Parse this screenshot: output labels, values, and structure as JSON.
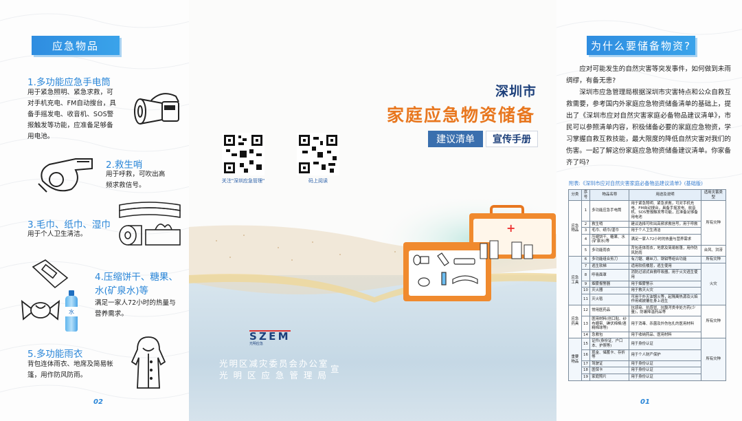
{
  "left": {
    "title": "应急物品",
    "page_number": "02",
    "items": [
      {
        "heading": "1.多功能应急手电筒",
        "desc": "用于紧急照明、紧急求救，可对手机充电、FM自动搜台，具备手摇发电、收音机、SOS警报触发等功能，应准备足够备用电池。"
      },
      {
        "heading": "2.救生哨",
        "desc": "用于呼救，可吹出高频求救信号。"
      },
      {
        "heading": "3.毛巾、纸巾、湿巾",
        "desc": "用于个人卫生清洁。"
      },
      {
        "heading": "4.压缩饼干、糖果、水(矿泉水)等",
        "desc": "满足一家人72小时的热量与营养需求。"
      },
      {
        "heading": "5.多功能雨衣",
        "desc": "背包连体雨衣、地席及简易帐篷，用作防风防雨。"
      }
    ],
    "water_label": "水"
  },
  "middle": {
    "title_line1": "深圳市",
    "title_line2": "家庭应急物资储备",
    "tag1": "建议清单",
    "tag2": "宣传手册",
    "qr1_caption": "关注\"深圳应急管理\"",
    "qr2_caption": "码上阅读",
    "logo_text": "光明应急",
    "org_line1": "光明区减灾委员会办公室",
    "org_line2": "光 明 区 应 急 管 理 局",
    "org_suffix": "宣",
    "kit_cross_label": "+"
  },
  "right": {
    "title": "为什么要储备物资?",
    "paragraphs": [
      "应对可能发生的自然灾害等突发事件，如何做到未雨绸缪，有备无患?",
      "深圳市应急管理局根据深圳市灾害特点和公众自救互救需要，参考国内外家庭应急物资储备清单的基础上，提出了《深圳市应对自然灾害家庭必备物品建议清单》，市民可以参照清单内容，积极储备必要的家庭应急物资，学习掌握自救互救技能，最大限度的降低自然灾害对我们的伤害。一起了解这份家庭应急物资储备建议清单。你家备齐了吗?"
    ],
    "annex_title": "附表:《深圳市应对自然灾害家庭必备物品建议清单》(基础版)",
    "page_number": "01",
    "table": {
      "headers": [
        "分类",
        "序号",
        "物品名称",
        "用途及说明",
        "适用灾害类型"
      ],
      "groups": [
        {
          "category": "应急物品",
          "rows": [
            {
              "no": "1",
              "name": "多功能应急手电筒",
              "use": "用于紧急照明、紧急求救，可对手机充电、FM自动搜台，具备手摇发电、收音机、SOS警报触发等功能，应准备足够备用电池"
            },
            {
              "no": "2",
              "name": "救生哨",
              "use": "建议选择可吹出高频求救信号，用于呼救"
            },
            {
              "no": "3",
              "name": "毛巾、纸巾/湿巾",
              "use": "用于个人卫生清洁"
            },
            {
              "no": "4",
              "name": "压缩饼干、糖果、水(矿泉水)等",
              "use": "满足一家人72小时的热量与营养需求"
            },
            {
              "no": "5",
              "name": "多功能雨衣",
              "use": "背包连体雨衣，地席及简易帐篷，用作防风防雨"
            }
          ]
        },
        {
          "category": "应急工具",
          "rows": [
            {
              "no": "6",
              "name": "多功能组合剪刀",
              "use": "有刀锯、螺丝刀、钢钳等组合功能"
            },
            {
              "no": "7",
              "name": "逃生软梯",
              "use": "适用较低楼层，逃生使用"
            },
            {
              "no": "8",
              "name": "呼吸面罩",
              "use": "消防过滤式自救呼吸器，用于火灾逃生使用"
            },
            {
              "no": "9",
              "name": "烟雾报警器",
              "use": "用于烟雾警示"
            },
            {
              "no": "10",
              "name": "灭火器",
              "use": "用于救灭火灾"
            },
            {
              "no": "11",
              "name": "灭火毯",
              "use": "可用于扑灭油锅火等，起隔离热源及火焰作用或披覆在身上逃生"
            }
          ]
        },
        {
          "category": "应急药具",
          "rows": [
            {
              "no": "12",
              "name": "常用医药品",
              "use": "抗感染、抗感冒、抗腹泻类非处方药(少量)，防暑降温药品等"
            },
            {
              "no": "13",
              "name": "医用材料(创口贴、纱布绷带、碘伏棉棒/酒精棉球等)",
              "use": "用于消毒、杀菌及外伤包扎的医用材料"
            },
            {
              "no": "14",
              "name": "急救包",
              "use": "用于收纳药品、医用材料"
            }
          ]
        },
        {
          "category": "重要物品",
          "rows": [
            {
              "no": "15",
              "name": "证件(身份证、户口本、护照等)",
              "use": "用于身份认证"
            },
            {
              "no": "16",
              "name": "现金、储蓄卡、存折等",
              "use": "用于个人财产保护"
            },
            {
              "no": "17",
              "name": "驾驶证",
              "use": "用于身份认证"
            },
            {
              "no": "18",
              "name": "医保卡",
              "use": "用于身份认证"
            },
            {
              "no": "19",
              "name": "家庭照片",
              "use": "用于身份认证"
            }
          ]
        }
      ],
      "type_all": "所有灾种",
      "type_typhoon_flood": "台风、洪涝",
      "type_fire": "火灾"
    }
  },
  "colors": {
    "accent_blue": "#2a86d8",
    "brand_orange": "#e8771f",
    "navy": "#1c3f7a"
  }
}
